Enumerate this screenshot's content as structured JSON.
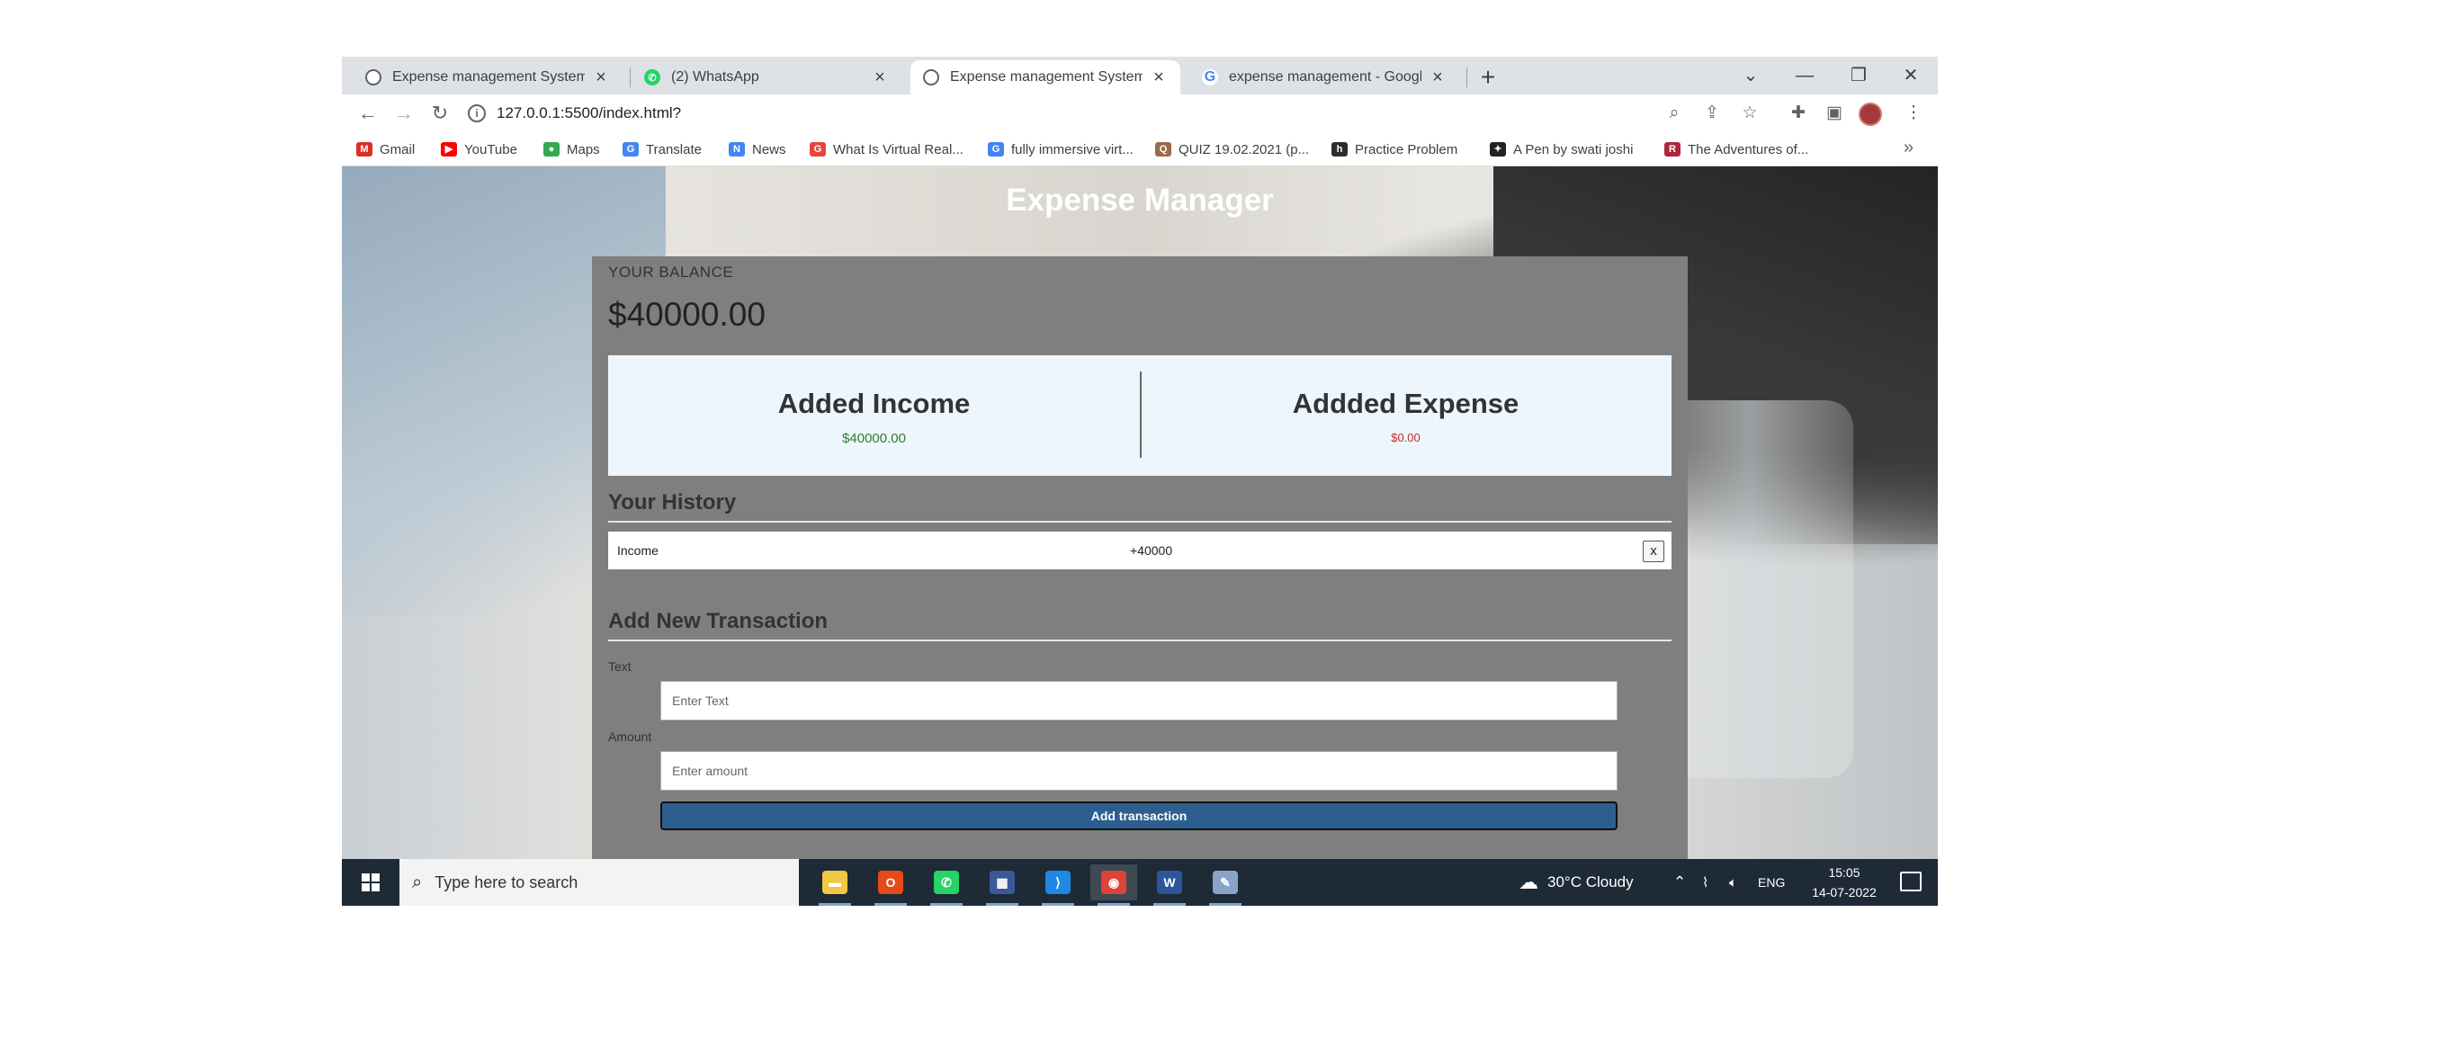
{
  "browser": {
    "tabs": [
      {
        "label": "Expense management System",
        "icon": "globe-icon",
        "active": false
      },
      {
        "label": "(2) WhatsApp",
        "icon": "whatsapp-icon",
        "active": false
      },
      {
        "label": "Expense management System",
        "icon": "globe-icon",
        "active": true
      },
      {
        "label": "expense management - Google S",
        "icon": "google-icon",
        "active": false
      }
    ],
    "new_tab": "+",
    "url": "127.0.0.1:5500/index.html?",
    "bookmarks": [
      {
        "label": "Gmail",
        "icon": "gmail-icon",
        "color": "#d93025",
        "glyph": "M"
      },
      {
        "label": "YouTube",
        "icon": "youtube-icon",
        "color": "#ff0000",
        "glyph": "▶"
      },
      {
        "label": "Maps",
        "icon": "maps-icon",
        "color": "#34a853",
        "glyph": "●"
      },
      {
        "label": "Translate",
        "icon": "translate-icon",
        "color": "#4285f4",
        "glyph": "G"
      },
      {
        "label": "News",
        "icon": "news-icon",
        "color": "#4285f4",
        "glyph": "N"
      },
      {
        "label": "What Is Virtual Real...",
        "icon": "site-icon",
        "color": "#e8453c",
        "glyph": "G"
      },
      {
        "label": "fully immersive virt...",
        "icon": "google-icon",
        "color": "#4285f4",
        "glyph": "G"
      },
      {
        "label": "QUIZ 19.02.2021 (p...",
        "icon": "quiz-icon",
        "color": "#9c6b4a",
        "glyph": "Q"
      },
      {
        "label": "Practice Problem",
        "icon": "hackerrank-icon",
        "color": "#2d2d2d",
        "glyph": "h"
      },
      {
        "label": "A Pen by swati joshi",
        "icon": "codepen-icon",
        "color": "#222222",
        "glyph": "✦"
      },
      {
        "label": "The Adventures of...",
        "icon": "site-icon",
        "color": "#b0263b",
        "glyph": "R"
      }
    ]
  },
  "app": {
    "title": "Expense Manager",
    "balance_label": "YOUR BALANCE",
    "balance": "$40000.00",
    "income_title": "Added Income",
    "income_amount": "$40000.00",
    "expense_title": "Addded Expense",
    "expense_amount": "$0.00",
    "history_title": "Your History",
    "history": [
      {
        "text": "Income",
        "amount": "+40000",
        "delete_label": "x"
      }
    ],
    "form_title": "Add New Transaction",
    "text_label": "Text",
    "text_placeholder": "Enter Text",
    "amount_label": "Amount",
    "amount_placeholder": "Enter amount",
    "submit_label": "Add transaction"
  },
  "taskbar": {
    "search_placeholder": "Type here to search",
    "apps": [
      {
        "name": "file-explorer",
        "color": "#f2c744",
        "glyph": "▬",
        "active": false
      },
      {
        "name": "office",
        "color": "#e64a19",
        "glyph": "O",
        "active": false
      },
      {
        "name": "whatsapp",
        "color": "#25d366",
        "glyph": "✆",
        "active": false
      },
      {
        "name": "calculator-app",
        "color": "#3b5998",
        "glyph": "▦",
        "active": false
      },
      {
        "name": "vscode",
        "color": "#1e88e5",
        "glyph": "⟩",
        "active": false
      },
      {
        "name": "chrome",
        "color": "#db4437",
        "glyph": "◉",
        "active": true
      },
      {
        "name": "word",
        "color": "#2b579a",
        "glyph": "W",
        "active": false
      },
      {
        "name": "paint",
        "color": "#8aa4c8",
        "glyph": "✎",
        "active": false
      }
    ],
    "weather": "30°C  Cloudy",
    "language": "ENG",
    "time": "15:05",
    "date": "14-07-2022"
  }
}
